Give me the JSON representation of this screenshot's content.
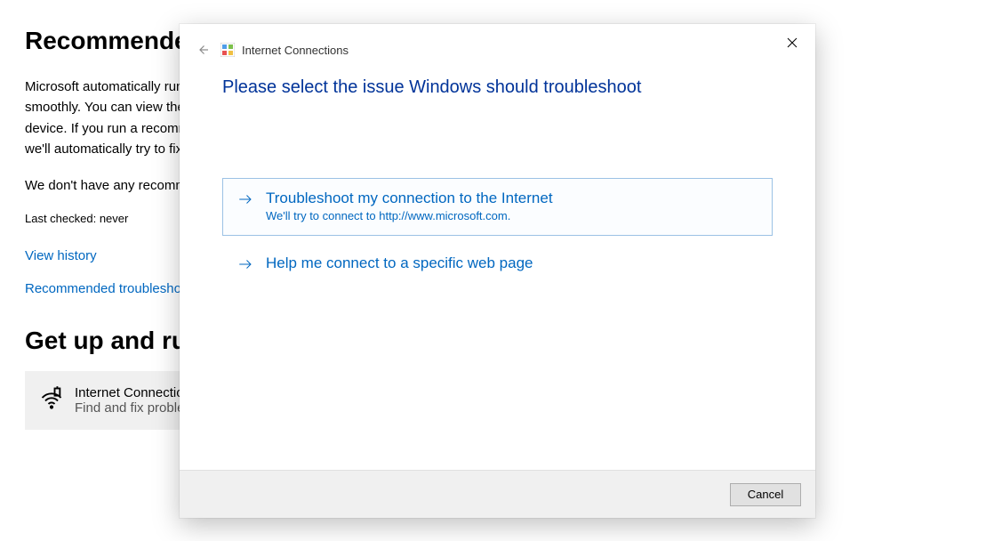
{
  "bg": {
    "heading": "Recommended troubleshooting",
    "para": "Microsoft automatically runs troubleshooters on your device to keep it running smoothly. You can view the recommendations below that could help with your device. If you run a recommended troubleshooter and the problem comes back, we'll automatically try to fix it for you again.",
    "no_recs": "We don't have any recommendations right now.",
    "last_checked": "Last checked: never",
    "link_history": "View history",
    "link_settings": "Recommended troubleshooter history",
    "heading2": "Get up and running",
    "tile_title": "Internet Connections",
    "tile_desc": "Find and fix problems with connecting to the Internet or to websites."
  },
  "dialog": {
    "wizard_title": "Internet Connections",
    "close": "Close",
    "main_instruction": "Please select the issue Windows should troubleshoot",
    "option1_title": "Troubleshoot my connection to the Internet",
    "option1_sub": "We'll try to connect to http://www.microsoft.com.",
    "option2_title": "Help me connect to a specific web page",
    "cancel": "Cancel"
  }
}
